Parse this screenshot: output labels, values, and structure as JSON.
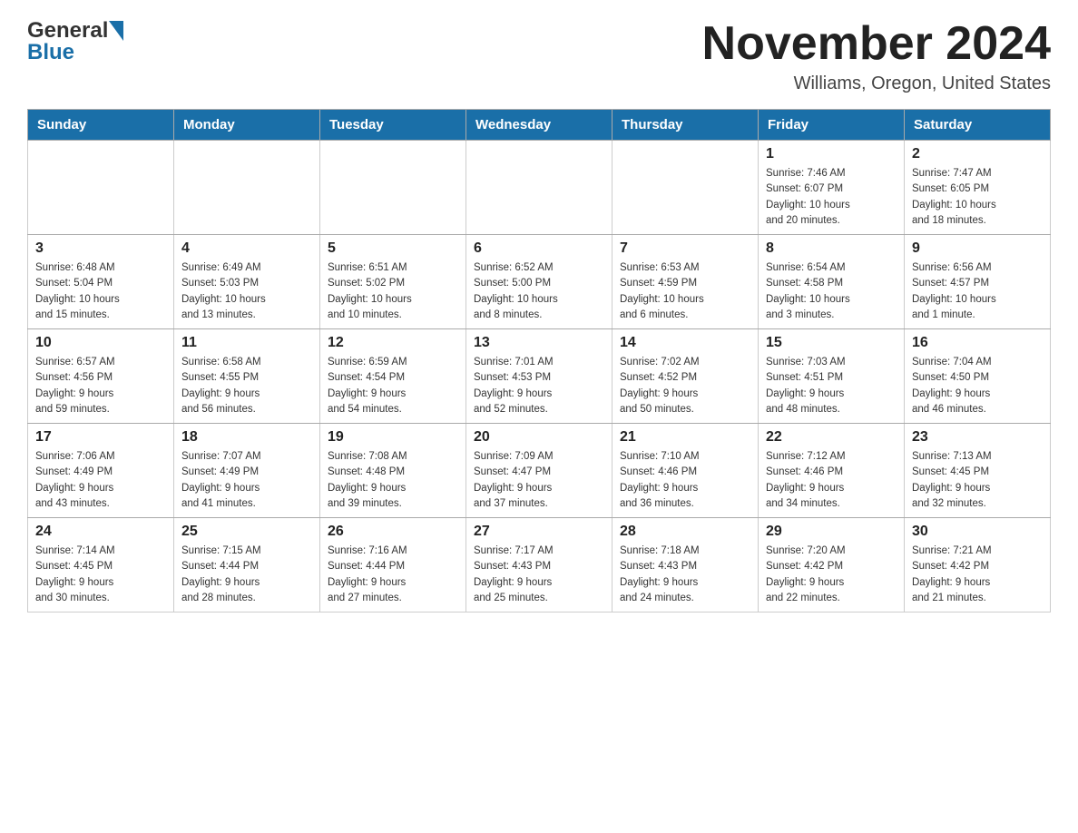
{
  "header": {
    "logo_general": "General",
    "logo_blue": "Blue",
    "month_title": "November 2024",
    "location": "Williams, Oregon, United States"
  },
  "days_of_week": [
    "Sunday",
    "Monday",
    "Tuesday",
    "Wednesday",
    "Thursday",
    "Friday",
    "Saturday"
  ],
  "weeks": [
    {
      "days": [
        {
          "number": "",
          "info": ""
        },
        {
          "number": "",
          "info": ""
        },
        {
          "number": "",
          "info": ""
        },
        {
          "number": "",
          "info": ""
        },
        {
          "number": "",
          "info": ""
        },
        {
          "number": "1",
          "info": "Sunrise: 7:46 AM\nSunset: 6:07 PM\nDaylight: 10 hours\nand 20 minutes."
        },
        {
          "number": "2",
          "info": "Sunrise: 7:47 AM\nSunset: 6:05 PM\nDaylight: 10 hours\nand 18 minutes."
        }
      ]
    },
    {
      "days": [
        {
          "number": "3",
          "info": "Sunrise: 6:48 AM\nSunset: 5:04 PM\nDaylight: 10 hours\nand 15 minutes."
        },
        {
          "number": "4",
          "info": "Sunrise: 6:49 AM\nSunset: 5:03 PM\nDaylight: 10 hours\nand 13 minutes."
        },
        {
          "number": "5",
          "info": "Sunrise: 6:51 AM\nSunset: 5:02 PM\nDaylight: 10 hours\nand 10 minutes."
        },
        {
          "number": "6",
          "info": "Sunrise: 6:52 AM\nSunset: 5:00 PM\nDaylight: 10 hours\nand 8 minutes."
        },
        {
          "number": "7",
          "info": "Sunrise: 6:53 AM\nSunset: 4:59 PM\nDaylight: 10 hours\nand 6 minutes."
        },
        {
          "number": "8",
          "info": "Sunrise: 6:54 AM\nSunset: 4:58 PM\nDaylight: 10 hours\nand 3 minutes."
        },
        {
          "number": "9",
          "info": "Sunrise: 6:56 AM\nSunset: 4:57 PM\nDaylight: 10 hours\nand 1 minute."
        }
      ]
    },
    {
      "days": [
        {
          "number": "10",
          "info": "Sunrise: 6:57 AM\nSunset: 4:56 PM\nDaylight: 9 hours\nand 59 minutes."
        },
        {
          "number": "11",
          "info": "Sunrise: 6:58 AM\nSunset: 4:55 PM\nDaylight: 9 hours\nand 56 minutes."
        },
        {
          "number": "12",
          "info": "Sunrise: 6:59 AM\nSunset: 4:54 PM\nDaylight: 9 hours\nand 54 minutes."
        },
        {
          "number": "13",
          "info": "Sunrise: 7:01 AM\nSunset: 4:53 PM\nDaylight: 9 hours\nand 52 minutes."
        },
        {
          "number": "14",
          "info": "Sunrise: 7:02 AM\nSunset: 4:52 PM\nDaylight: 9 hours\nand 50 minutes."
        },
        {
          "number": "15",
          "info": "Sunrise: 7:03 AM\nSunset: 4:51 PM\nDaylight: 9 hours\nand 48 minutes."
        },
        {
          "number": "16",
          "info": "Sunrise: 7:04 AM\nSunset: 4:50 PM\nDaylight: 9 hours\nand 46 minutes."
        }
      ]
    },
    {
      "days": [
        {
          "number": "17",
          "info": "Sunrise: 7:06 AM\nSunset: 4:49 PM\nDaylight: 9 hours\nand 43 minutes."
        },
        {
          "number": "18",
          "info": "Sunrise: 7:07 AM\nSunset: 4:49 PM\nDaylight: 9 hours\nand 41 minutes."
        },
        {
          "number": "19",
          "info": "Sunrise: 7:08 AM\nSunset: 4:48 PM\nDaylight: 9 hours\nand 39 minutes."
        },
        {
          "number": "20",
          "info": "Sunrise: 7:09 AM\nSunset: 4:47 PM\nDaylight: 9 hours\nand 37 minutes."
        },
        {
          "number": "21",
          "info": "Sunrise: 7:10 AM\nSunset: 4:46 PM\nDaylight: 9 hours\nand 36 minutes."
        },
        {
          "number": "22",
          "info": "Sunrise: 7:12 AM\nSunset: 4:46 PM\nDaylight: 9 hours\nand 34 minutes."
        },
        {
          "number": "23",
          "info": "Sunrise: 7:13 AM\nSunset: 4:45 PM\nDaylight: 9 hours\nand 32 minutes."
        }
      ]
    },
    {
      "days": [
        {
          "number": "24",
          "info": "Sunrise: 7:14 AM\nSunset: 4:45 PM\nDaylight: 9 hours\nand 30 minutes."
        },
        {
          "number": "25",
          "info": "Sunrise: 7:15 AM\nSunset: 4:44 PM\nDaylight: 9 hours\nand 28 minutes."
        },
        {
          "number": "26",
          "info": "Sunrise: 7:16 AM\nSunset: 4:44 PM\nDaylight: 9 hours\nand 27 minutes."
        },
        {
          "number": "27",
          "info": "Sunrise: 7:17 AM\nSunset: 4:43 PM\nDaylight: 9 hours\nand 25 minutes."
        },
        {
          "number": "28",
          "info": "Sunrise: 7:18 AM\nSunset: 4:43 PM\nDaylight: 9 hours\nand 24 minutes."
        },
        {
          "number": "29",
          "info": "Sunrise: 7:20 AM\nSunset: 4:42 PM\nDaylight: 9 hours\nand 22 minutes."
        },
        {
          "number": "30",
          "info": "Sunrise: 7:21 AM\nSunset: 4:42 PM\nDaylight: 9 hours\nand 21 minutes."
        }
      ]
    }
  ]
}
